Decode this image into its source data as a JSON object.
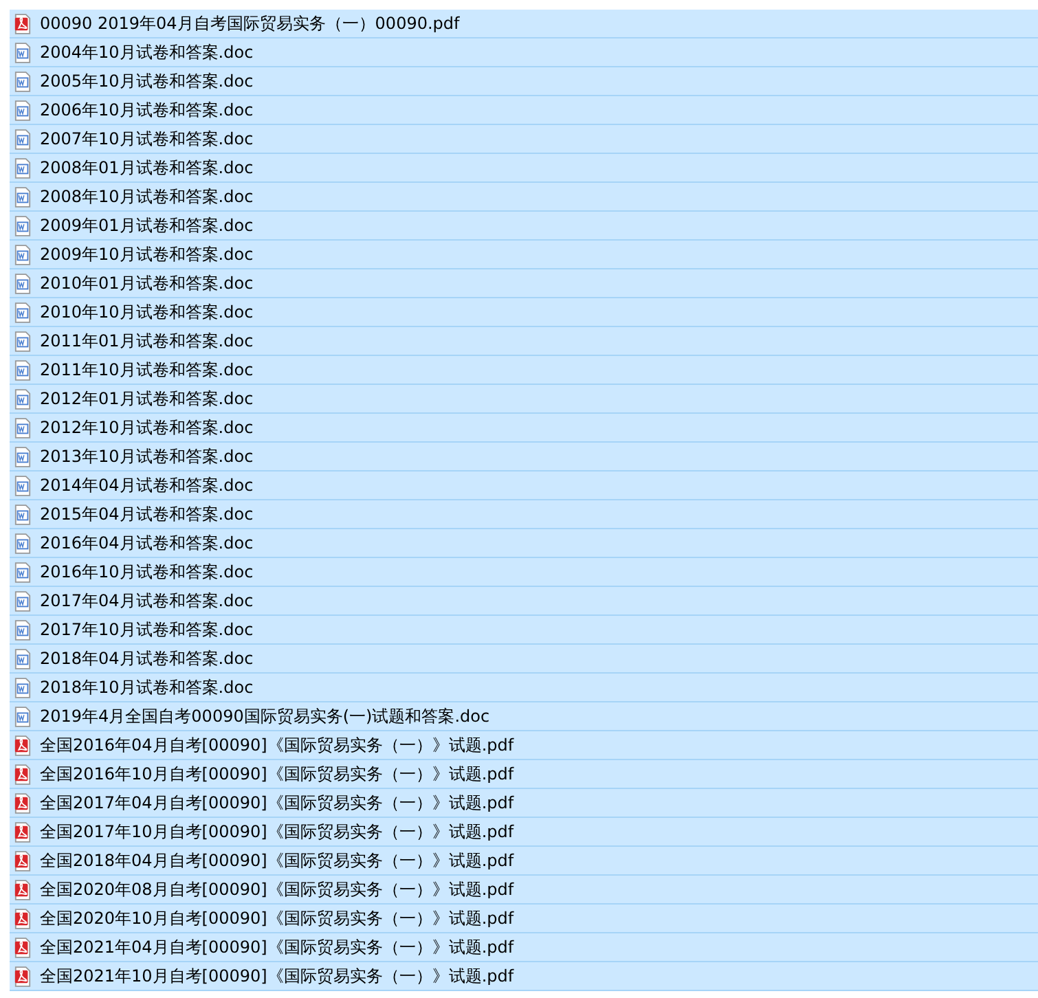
{
  "files": [
    {
      "name": "00090 2019年04月自考国际贸易实务（一）00090.pdf",
      "kind": "pdf",
      "selected": true
    },
    {
      "name": "2004年10月试卷和答案.doc",
      "kind": "doc",
      "selected": true
    },
    {
      "name": "2005年10月试卷和答案.doc",
      "kind": "doc",
      "selected": true
    },
    {
      "name": "2006年10月试卷和答案.doc",
      "kind": "doc",
      "selected": true
    },
    {
      "name": "2007年10月试卷和答案.doc",
      "kind": "doc",
      "selected": true
    },
    {
      "name": "2008年01月试卷和答案.doc",
      "kind": "doc",
      "selected": true
    },
    {
      "name": "2008年10月试卷和答案.doc",
      "kind": "doc",
      "selected": true
    },
    {
      "name": "2009年01月试卷和答案.doc",
      "kind": "doc",
      "selected": true
    },
    {
      "name": "2009年10月试卷和答案.doc",
      "kind": "doc",
      "selected": true
    },
    {
      "name": "2010年01月试卷和答案.doc",
      "kind": "doc",
      "selected": true
    },
    {
      "name": "2010年10月试卷和答案.doc",
      "kind": "doc",
      "selected": true
    },
    {
      "name": "2011年01月试卷和答案.doc",
      "kind": "doc",
      "selected": true
    },
    {
      "name": "2011年10月试卷和答案.doc",
      "kind": "doc",
      "selected": true
    },
    {
      "name": "2012年01月试卷和答案.doc",
      "kind": "doc",
      "selected": true
    },
    {
      "name": "2012年10月试卷和答案.doc",
      "kind": "doc",
      "selected": true
    },
    {
      "name": "2013年10月试卷和答案.doc",
      "kind": "doc",
      "selected": true
    },
    {
      "name": "2014年04月试卷和答案.doc",
      "kind": "doc",
      "selected": true
    },
    {
      "name": "2015年04月试卷和答案.doc",
      "kind": "doc",
      "selected": true
    },
    {
      "name": "2016年04月试卷和答案.doc",
      "kind": "doc",
      "selected": true
    },
    {
      "name": "2016年10月试卷和答案.doc",
      "kind": "doc",
      "selected": true
    },
    {
      "name": "2017年04月试卷和答案.doc",
      "kind": "doc",
      "selected": true
    },
    {
      "name": "2017年10月试卷和答案.doc",
      "kind": "doc",
      "selected": true
    },
    {
      "name": "2018年04月试卷和答案.doc",
      "kind": "doc",
      "selected": true
    },
    {
      "name": "2018年10月试卷和答案.doc",
      "kind": "doc",
      "selected": true
    },
    {
      "name": "2019年4月全国自考00090国际贸易实务(一)试题和答案.doc",
      "kind": "doc",
      "selected": true
    },
    {
      "name": "全国2016年04月自考[00090]《国际贸易实务（一）》试题.pdf",
      "kind": "pdf",
      "selected": true
    },
    {
      "name": "全国2016年10月自考[00090]《国际贸易实务（一）》试题.pdf",
      "kind": "pdf",
      "selected": true
    },
    {
      "name": "全国2017年04月自考[00090]《国际贸易实务（一）》试题.pdf",
      "kind": "pdf",
      "selected": true
    },
    {
      "name": "全国2017年10月自考[00090]《国际贸易实务（一）》试题.pdf",
      "kind": "pdf",
      "selected": true
    },
    {
      "name": "全国2018年04月自考[00090]《国际贸易实务（一）》试题.pdf",
      "kind": "pdf",
      "selected": true
    },
    {
      "name": "全国2020年08月自考[00090]《国际贸易实务（一）》试题.pdf",
      "kind": "pdf",
      "selected": true
    },
    {
      "name": "全国2020年10月自考[00090]《国际贸易实务（一）》试题.pdf",
      "kind": "pdf",
      "selected": true
    },
    {
      "name": "全国2021年04月自考[00090]《国际贸易实务（一）》试题.pdf",
      "kind": "pdf",
      "selected": true
    },
    {
      "name": "全国2021年10月自考[00090]《国际贸易实务（一）》试题.pdf",
      "kind": "pdf",
      "selected": true
    }
  ]
}
